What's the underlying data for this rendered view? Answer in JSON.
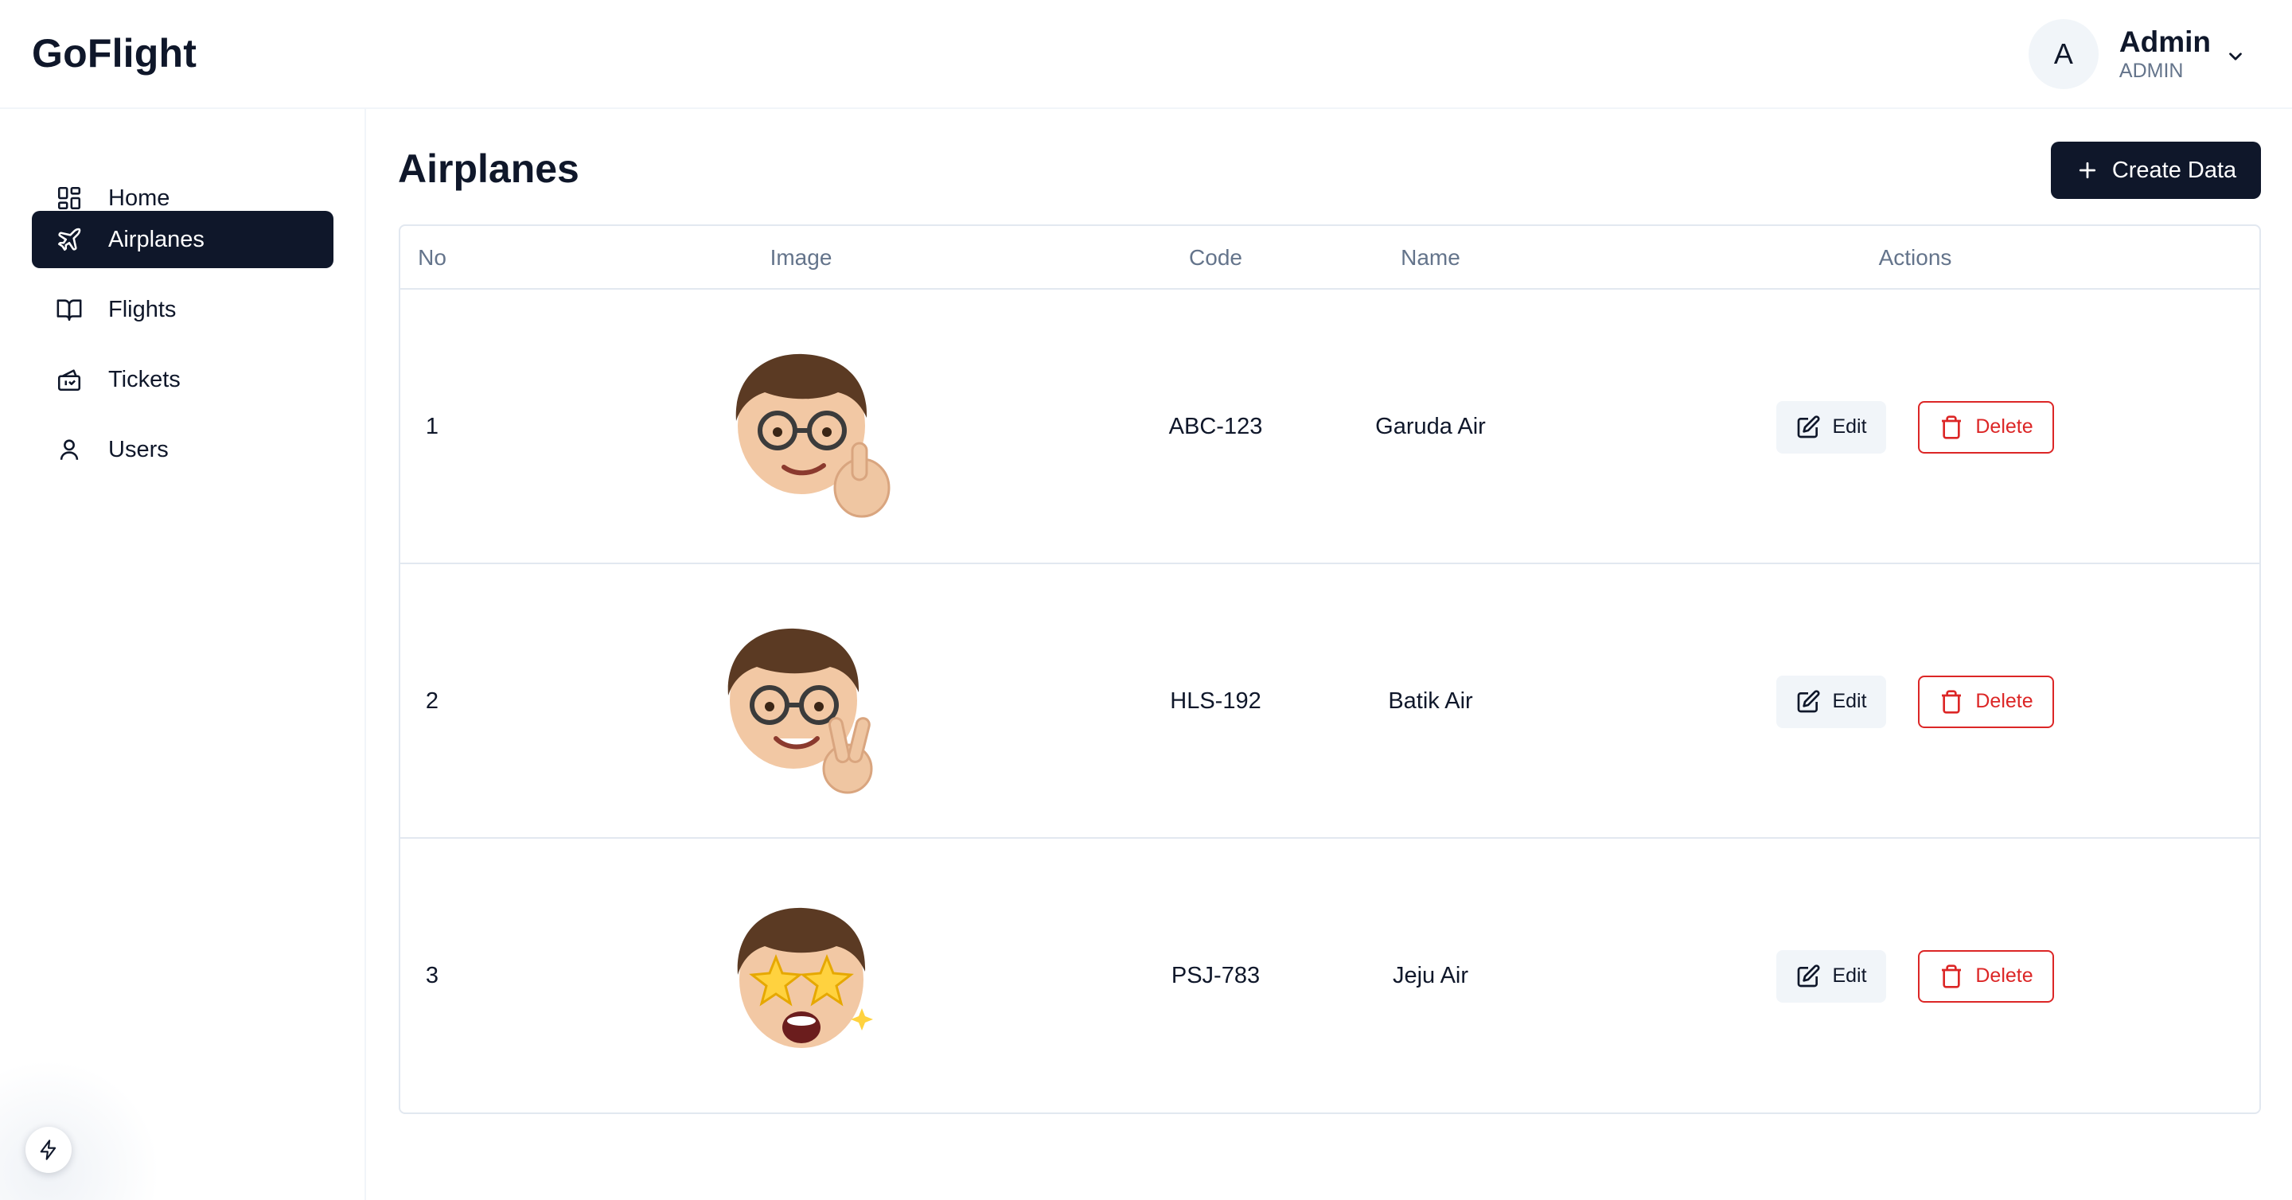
{
  "app": {
    "brand": "GoFlight"
  },
  "user": {
    "initial": "A",
    "name": "Admin",
    "role": "ADMIN"
  },
  "sidebar": {
    "items": [
      {
        "label": "Home",
        "icon": "dashboard-icon",
        "active": false
      },
      {
        "label": "Airplanes",
        "icon": "airplane-icon",
        "active": true
      },
      {
        "label": "Flights",
        "icon": "book-open-icon",
        "active": false
      },
      {
        "label": "Tickets",
        "icon": "ticket-icon",
        "active": false
      },
      {
        "label": "Users",
        "icon": "user-icon",
        "active": false
      }
    ]
  },
  "page": {
    "title": "Airplanes",
    "create_label": "Create Data"
  },
  "table": {
    "columns": [
      "No",
      "Image",
      "Code",
      "Name",
      "Actions"
    ],
    "edit_label": "Edit",
    "delete_label": "Delete",
    "rows": [
      {
        "no": "1",
        "image": "memoji-thumbs-up",
        "code": "ABC-123",
        "name": "Garuda Air"
      },
      {
        "no": "2",
        "image": "memoji-peace-sign",
        "code": "HLS-192",
        "name": "Batik Air"
      },
      {
        "no": "3",
        "image": "memoji-star-eyes",
        "code": "PSJ-783",
        "name": "Jeju Air"
      }
    ]
  },
  "colors": {
    "primary": "#0f172a",
    "muted": "#64748b",
    "border": "#e2e8f0",
    "danger": "#dc2626",
    "edit_bg": "#f1f5f9"
  }
}
